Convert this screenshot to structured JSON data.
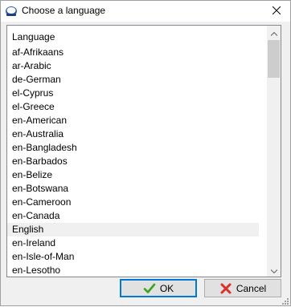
{
  "window": {
    "title": "Choose a language"
  },
  "list": {
    "header": "Language",
    "items": [
      {
        "label": "af-Afrikaans"
      },
      {
        "label": "ar-Arabic"
      },
      {
        "label": "de-German"
      },
      {
        "label": "el-Cyprus"
      },
      {
        "label": "el-Greece"
      },
      {
        "label": "en-American"
      },
      {
        "label": "en-Australia"
      },
      {
        "label": "en-Bangladesh"
      },
      {
        "label": "en-Barbados"
      },
      {
        "label": "en-Belize"
      },
      {
        "label": "en-Botswana"
      },
      {
        "label": "en-Cameroon"
      },
      {
        "label": "en-Canada"
      },
      {
        "label": "English",
        "selected": true
      },
      {
        "label": "en-Ireland"
      },
      {
        "label": "en-Isle-of-Man"
      },
      {
        "label": "en-Lesotho"
      }
    ]
  },
  "buttons": {
    "ok_label": "OK",
    "cancel_label": "Cancel"
  },
  "colors": {
    "ok_check": "#3aa31e",
    "cancel_x": "#d9302c",
    "selection_bg": "#f0f0f0"
  },
  "icons": {
    "app": "app-logo-icon",
    "close": "close-icon",
    "ok": "checkmark-icon",
    "cancel": "x-icon"
  }
}
